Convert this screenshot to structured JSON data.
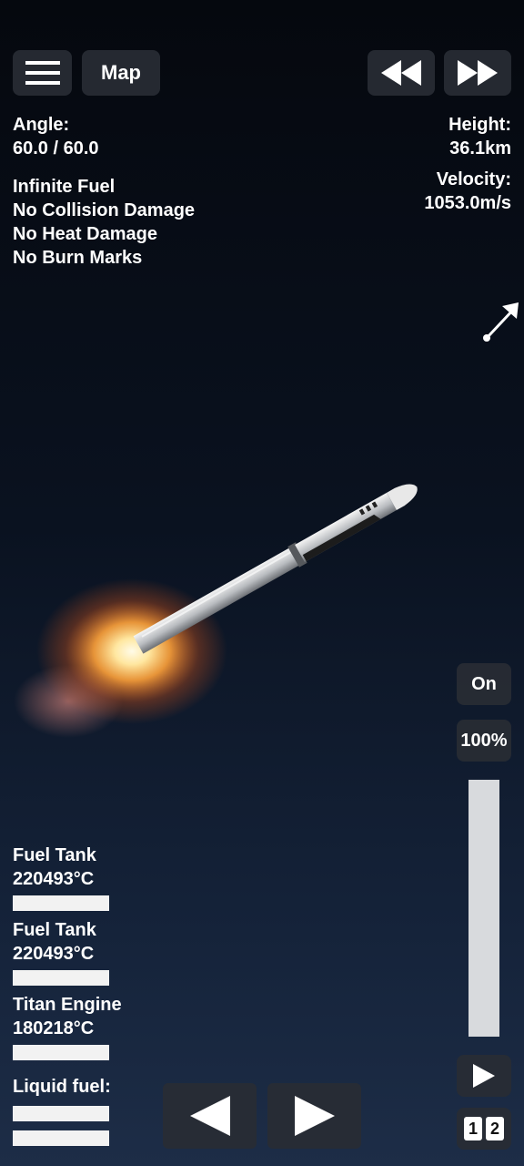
{
  "toolbar": {
    "menu_icon": "hamburger-menu-icon",
    "map_label": "Map",
    "rewind_icon": "rewind-icon",
    "fast_forward_icon": "fast-forward-icon"
  },
  "telemetry": {
    "angle_label": "Angle:",
    "angle_value": "60.0 / 60.0",
    "height_label": "Height:",
    "height_value": "36.1km",
    "velocity_label": "Velocity:",
    "velocity_value": "1053.0m/s"
  },
  "cheats": [
    "Infinite Fuel",
    "No Collision Damage",
    "No Heat Damage",
    "No Burn Marks"
  ],
  "direction_icon": "direction-arrow-icon",
  "throttle": {
    "toggle_label": "On",
    "percent_label": "100%",
    "level": 1.0
  },
  "parts": [
    {
      "name": "Fuel Tank",
      "temp": "220493°C",
      "level": 1.0
    },
    {
      "name": "Fuel Tank",
      "temp": "220493°C",
      "level": 1.0
    },
    {
      "name": "Titan Engine",
      "temp": "180218°C",
      "level": 1.0
    }
  ],
  "resources": {
    "liquid_fuel_label": "Liquid fuel:",
    "liquid_fuel_levels": [
      1.0,
      1.0
    ]
  },
  "controls": {
    "rotate_left_icon": "triangle-left-icon",
    "rotate_right_icon": "triangle-right-icon",
    "play_icon": "play-icon",
    "stage_1": "1",
    "stage_2": "2"
  },
  "colors": {
    "sky_top": "#05080e",
    "sky_bottom": "#1d2d47",
    "button_bg": "#282c34",
    "flame_core": "#fff6d0",
    "flame_outer": "#ff8a1a"
  }
}
